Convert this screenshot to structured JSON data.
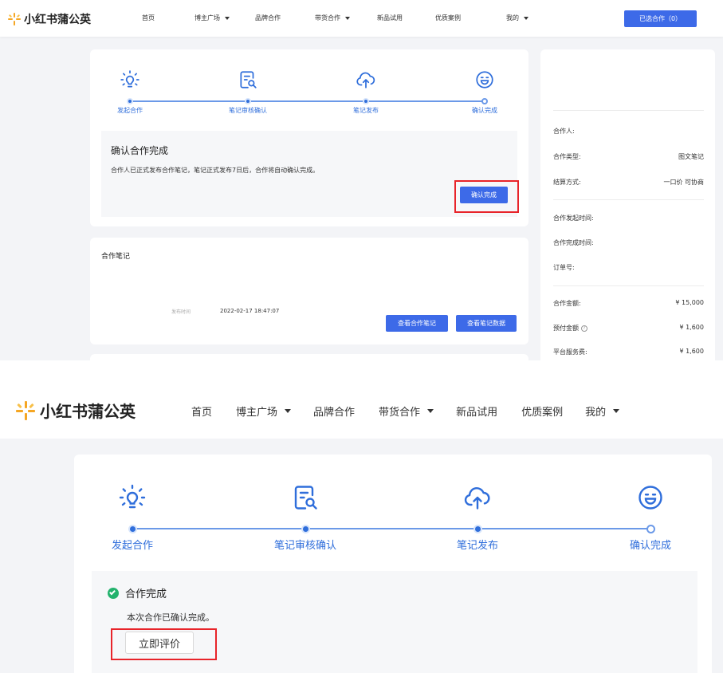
{
  "brand": {
    "name": "小红书蒲公英"
  },
  "nav": {
    "items": [
      {
        "label": "首页",
        "caret": false
      },
      {
        "label": "博主广场",
        "caret": true
      },
      {
        "label": "品牌合作",
        "caret": false
      },
      {
        "label": "带货合作",
        "caret": true
      },
      {
        "label": "新品试用",
        "caret": false
      },
      {
        "label": "优质案例",
        "caret": false
      },
      {
        "label": "我的",
        "caret": true
      }
    ],
    "selected_button": "已选合作（0）"
  },
  "steps": [
    {
      "label": "发起合作",
      "icon": "lightbulb-icon"
    },
    {
      "label": "笔记审核确认",
      "icon": "note-review-icon"
    },
    {
      "label": "笔记发布",
      "icon": "cloud-upload-icon"
    },
    {
      "label": "确认完成",
      "icon": "smile-icon"
    }
  ],
  "confirm_panel": {
    "title": "确认合作完成",
    "desc": "合作人已正式发布合作笔记，笔记正式发布7日后，合作将自动确认完成。",
    "button": "确认完成"
  },
  "note_card": {
    "title": "合作笔记",
    "publish_label": "发布时间",
    "publish_time": "2022-02-17 18:47:07",
    "view_note_button": "查看合作笔记",
    "view_data_button": "查看笔记数据"
  },
  "sidebar": {
    "rows": [
      {
        "label": "合作人:",
        "value": ""
      },
      {
        "label": "合作类型:",
        "value": "图文笔记"
      },
      {
        "label": "结算方式:",
        "value": "一口价 可协商"
      },
      {
        "label": "合作发起时间:",
        "value": ""
      },
      {
        "label": "合作完成时间:",
        "value": ""
      },
      {
        "label": "订单号:",
        "value": ""
      },
      {
        "label": "合作金额:",
        "value": "¥ 15,000"
      },
      {
        "label": "预付金额",
        "value": "¥ 1,600"
      },
      {
        "label": "平台服务费:",
        "value": "¥ 1,600"
      }
    ]
  },
  "complete_panel": {
    "title": "合作完成",
    "desc": "本次合作已确认完成。",
    "button": "立即评价"
  },
  "colors": {
    "primary": "#3d6ae8",
    "step": "#2f6edb",
    "highlight": "#e8242a",
    "success": "#23b26d"
  }
}
